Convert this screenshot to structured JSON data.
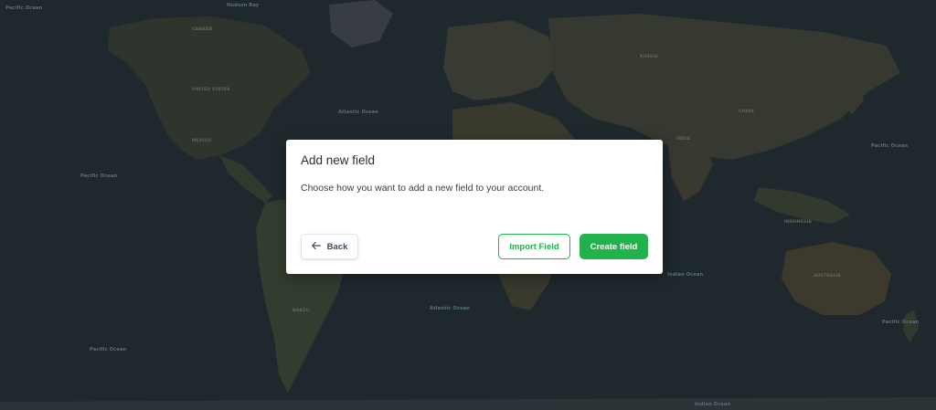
{
  "dialog": {
    "title": "Add new field",
    "description": "Choose how you want to add a new field to your account.",
    "back_label": "Back",
    "import_label": "Import Field",
    "create_label": "Create field"
  },
  "colors": {
    "primary_green": "#21b24b",
    "map_ocean": "#263236",
    "map_land": "#3f4436"
  },
  "map": {
    "labels": {
      "pacific_nw": "Pacific Ocean",
      "pacific_w": "Pacific Ocean",
      "pacific_sw": "Pacific Ocean",
      "pacific_e": "Pacific Ocean",
      "pacific_se": "Pacific Ocean",
      "atlantic_n": "Atlantic Ocean",
      "atlantic_s": "Atlantic Ocean",
      "indian": "Indian Ocean",
      "indian_s": "Indian Ocean",
      "hudson": "Hudson Bay",
      "australia": "AUSTRALIA",
      "canada": "CANADA",
      "united_states": "UNITED STATES",
      "mexico": "MEXICO",
      "brazil": "BRAZIL",
      "russia": "RUSSIA",
      "china": "CHINA",
      "india": "INDIA",
      "indonesia": "INDONESIA"
    }
  }
}
